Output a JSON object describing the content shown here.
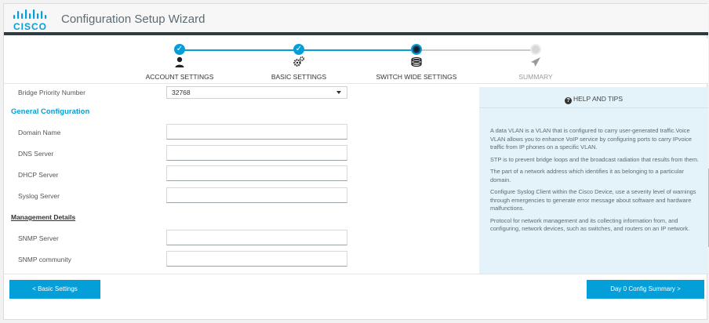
{
  "header": {
    "brand": "CISCO",
    "title": "Configuration Setup Wizard"
  },
  "steps": [
    {
      "label": "ACCOUNT SETTINGS",
      "state": "done"
    },
    {
      "label": "BASIC SETTINGS",
      "state": "done"
    },
    {
      "label": "SWITCH WIDE SETTINGS",
      "state": "current"
    },
    {
      "label": "SUMMARY",
      "state": "pending"
    }
  ],
  "form": {
    "bridge_priority_label": "Bridge Priority Number",
    "bridge_priority_value": "32768",
    "general_heading": "General Configuration",
    "domain_name_label": "Domain Name",
    "domain_name_value": "",
    "dns_server_label": "DNS Server",
    "dns_server_value": "",
    "dhcp_server_label": "DHCP Server",
    "dhcp_server_value": "",
    "syslog_server_label": "Syslog Server",
    "syslog_server_value": "",
    "management_heading": "Management Details",
    "snmp_server_label": "SNMP Server",
    "snmp_server_value": "",
    "snmp_community_label": "SNMP community",
    "snmp_community_value": ""
  },
  "help": {
    "title": "HELP AND TIPS",
    "tips": [
      "A data VLAN is a VLAN that is configured to carry user-generated traffic.Voice VLAN allows you to enhance VoIP service by configuring ports to carry IPvoice traffic from IP phones on a specific VLAN.",
      "STP is to prevent bridge loops and the broadcast radiation that results from them.",
      "The part of a network address which identifies it as belonging to a particular domain.",
      "Configure Syslog Client within the Cisco Device, use a severity level of warnings through emergencies to generate error message about software and hardware malfunctions.",
      "Protocol for network management and its collecting information from, and configuring, network devices, such as switches, and routers on an IP network."
    ]
  },
  "footer": {
    "back_label": "< Basic Settings",
    "next_label": "Day 0 Config Summary >"
  },
  "icons": {
    "step1": "user-icon",
    "step2": "gears-icon",
    "step3": "switch-icon",
    "step4": "paper-plane-icon",
    "help": "question-circle-icon"
  },
  "colors": {
    "accent": "#049fd9",
    "header_bar": "#2f3b42",
    "help_bg": "#e3f3f9"
  }
}
